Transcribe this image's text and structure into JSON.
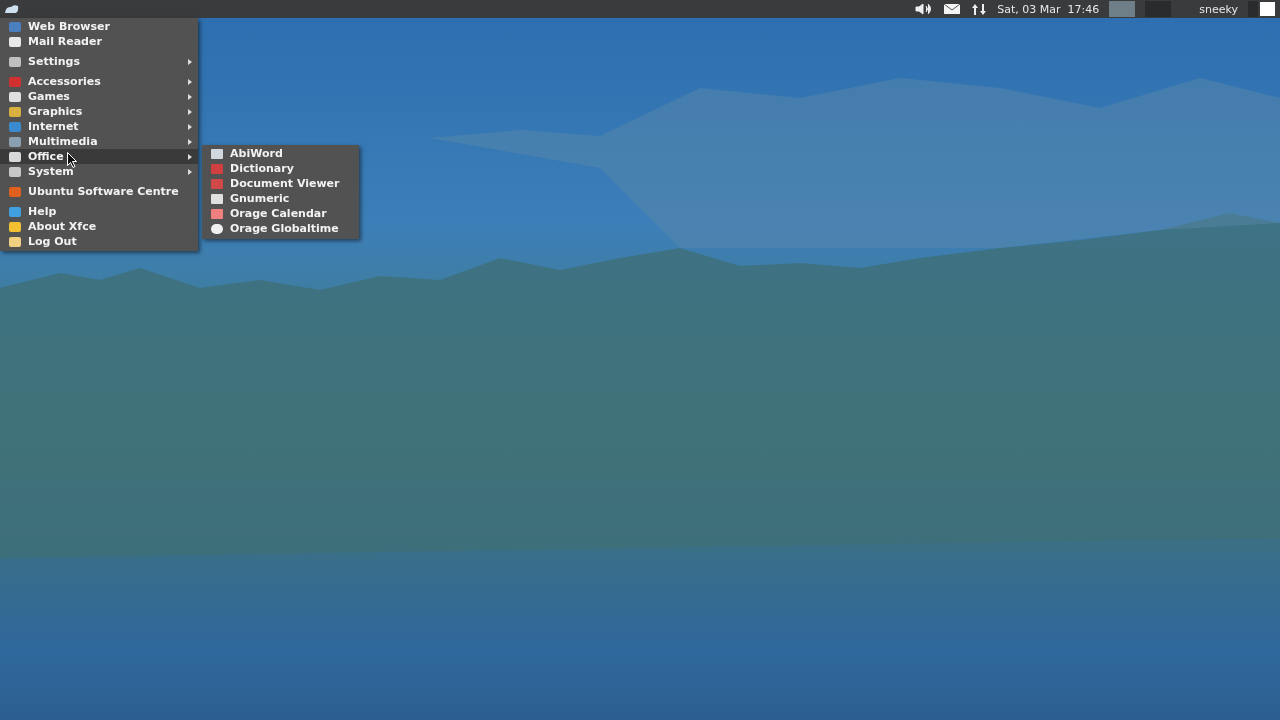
{
  "panel": {
    "clock": "Sat, 03 Mar  17:46",
    "user": "sneeky",
    "workspaces": [
      {
        "selected": true
      },
      {
        "selected": false
      }
    ]
  },
  "menu": {
    "items": [
      {
        "kind": "item",
        "label": "Web Browser",
        "submenu": false,
        "selected": false
      },
      {
        "kind": "item",
        "label": "Mail Reader",
        "submenu": false,
        "selected": false
      },
      {
        "kind": "separator"
      },
      {
        "kind": "item",
        "label": "Settings",
        "submenu": true,
        "selected": false
      },
      {
        "kind": "separator"
      },
      {
        "kind": "item",
        "label": "Accessories",
        "submenu": true,
        "selected": false
      },
      {
        "kind": "item",
        "label": "Games",
        "submenu": true,
        "selected": false
      },
      {
        "kind": "item",
        "label": "Graphics",
        "submenu": true,
        "selected": false
      },
      {
        "kind": "item",
        "label": "Internet",
        "submenu": true,
        "selected": false
      },
      {
        "kind": "item",
        "label": "Multimedia",
        "submenu": true,
        "selected": false
      },
      {
        "kind": "item",
        "label": "Office",
        "submenu": true,
        "selected": true
      },
      {
        "kind": "item",
        "label": "System",
        "submenu": true,
        "selected": false
      },
      {
        "kind": "separator"
      },
      {
        "kind": "item",
        "label": "Ubuntu Software Centre",
        "submenu": false,
        "selected": false
      },
      {
        "kind": "separator"
      },
      {
        "kind": "item",
        "label": "Help",
        "submenu": false,
        "selected": false
      },
      {
        "kind": "item",
        "label": "About Xfce",
        "submenu": false,
        "selected": false
      },
      {
        "kind": "item",
        "label": "Log Out",
        "submenu": false,
        "selected": false
      }
    ]
  },
  "submenu": {
    "items": [
      {
        "label": "AbiWord",
        "selected": false
      },
      {
        "label": "Dictionary",
        "selected": false
      },
      {
        "label": "Document Viewer",
        "selected": false
      },
      {
        "label": "Gnumeric",
        "selected": false
      },
      {
        "label": "Orage Calendar",
        "selected": false
      },
      {
        "label": "Orage Globaltime",
        "selected": false
      }
    ]
  }
}
